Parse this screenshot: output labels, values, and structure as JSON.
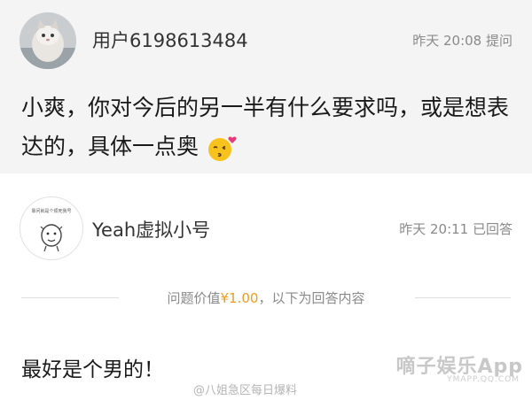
{
  "question": {
    "username": "用户6198613484",
    "time_label": "昨天 20:08 提问",
    "text": "小爽，你对今后的另一半有什么要求吗，或是想表达的，具体一点奥",
    "emoji_icon": "kiss-emoji-icon"
  },
  "answer": {
    "avatar_caption": "靠问就是个烦死我号",
    "username": "Yeah虚拟小号",
    "time_label": "昨天 20:11 已回答",
    "reward_prefix": "问题价值",
    "reward_value": "¥1.00",
    "reward_suffix": "，以下为回答内容",
    "text": "最好是个男的！"
  },
  "watermarks": {
    "weibo": "@八姐急区每日爆料",
    "brand": "嘀子娱乐App",
    "brand_sub": "YMAPP.QQ.COM"
  },
  "colors": {
    "question_bg": "#f4f4f4",
    "price": "#f29a1e",
    "muted_text": "#8a8a8a"
  }
}
